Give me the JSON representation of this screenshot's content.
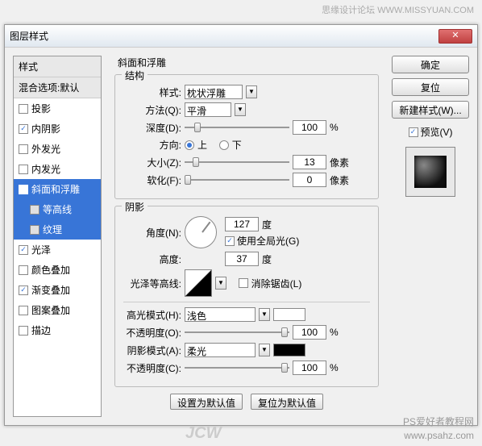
{
  "watermark_top": "思缘设计论坛  WWW.MISSYUAN.COM",
  "watermark_bottom_1": "PS爱好者教程网",
  "watermark_bottom_2": "www.psahz.com",
  "jcw": "JCW",
  "title": "图层样式",
  "left": {
    "head": "样式",
    "subhead": "混合选项:默认",
    "items": [
      {
        "label": "投影",
        "checked": false
      },
      {
        "label": "内阴影",
        "checked": true
      },
      {
        "label": "外发光",
        "checked": false
      },
      {
        "label": "内发光",
        "checked": false
      },
      {
        "label": "斜面和浮雕",
        "checked": true,
        "selected": true
      },
      {
        "label": "等高线",
        "sub": true
      },
      {
        "label": "纹理",
        "sub": true
      },
      {
        "label": "光泽",
        "checked": true
      },
      {
        "label": "颜色叠加",
        "checked": false
      },
      {
        "label": "渐变叠加",
        "checked": true
      },
      {
        "label": "图案叠加",
        "checked": false
      },
      {
        "label": "描边",
        "checked": false
      }
    ]
  },
  "section_title": "斜面和浮雕",
  "structure": {
    "legend": "结构",
    "style_label": "样式:",
    "style_value": "枕状浮雕",
    "method_label": "方法(Q):",
    "method_value": "平滑",
    "depth_label": "深度(D):",
    "depth_value": "100",
    "depth_unit": "%",
    "direction_label": "方向:",
    "dir_up": "上",
    "dir_down": "下",
    "size_label": "大小(Z):",
    "size_value": "13",
    "size_unit": "像素",
    "soften_label": "软化(F):",
    "soften_value": "0",
    "soften_unit": "像素"
  },
  "shading": {
    "legend": "阴影",
    "angle_label": "角度(N):",
    "angle_value": "127",
    "angle_unit": "度",
    "global_light": "使用全局光(G)",
    "altitude_label": "高度:",
    "altitude_value": "37",
    "altitude_unit": "度",
    "gloss_label": "光泽等高线:",
    "antialias": "消除锯齿(L)",
    "hi_mode_label": "高光模式(H):",
    "hi_mode_value": "浅色",
    "hi_color": "#ffffff",
    "hi_opacity_label": "不透明度(O):",
    "hi_opacity_value": "100",
    "hi_opacity_unit": "%",
    "sh_mode_label": "阴影模式(A):",
    "sh_mode_value": "柔光",
    "sh_color": "#000000",
    "sh_opacity_label": "不透明度(C):",
    "sh_opacity_value": "100",
    "sh_opacity_unit": "%"
  },
  "bottom": {
    "set_default": "设置为默认值",
    "reset_default": "复位为默认值"
  },
  "right": {
    "ok": "确定",
    "reset": "复位",
    "new_style": "新建样式(W)...",
    "preview": "预览(V)"
  }
}
